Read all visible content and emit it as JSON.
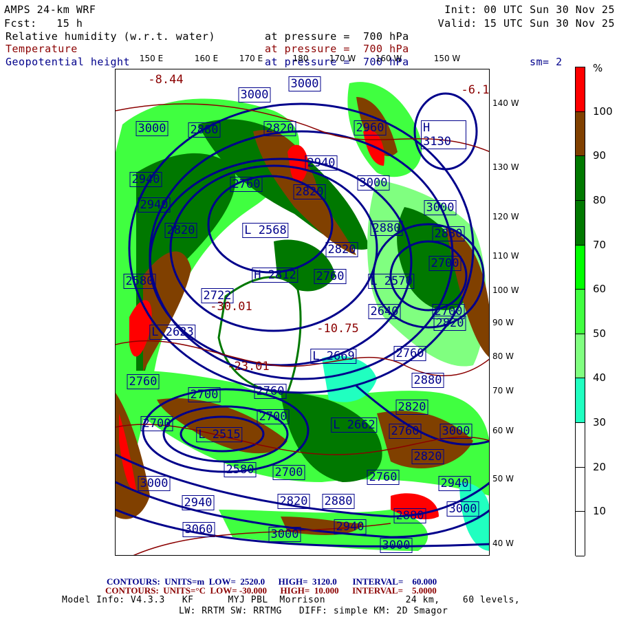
{
  "header": {
    "model": "AMPS 24-km WRF",
    "fcst": "Fcst:   15 h",
    "init": "Init: 00 UTC Sun 30 Nov 25",
    "valid": "Valid: 15 UTC Sun 30 Nov 25",
    "fields": [
      {
        "name": "Relative humidity (w.r.t. water)",
        "level": "at pressure =  700 hPa"
      },
      {
        "name": "Temperature",
        "level": "at pressure =  700 hPa"
      },
      {
        "name": "Geopotential height",
        "level": "at pressure =  700 hPa"
      }
    ],
    "smoothing": "sm= 2"
  },
  "colors": {
    "navy": "#00008b",
    "darkred": "#8b0000"
  },
  "longitude_labels": [
    "150 E",
    "160 E",
    "170 E",
    "180",
    "170 W",
    "160 W",
    "150 W"
  ],
  "latitude_labels": [
    "140 W",
    "130 W",
    "120 W",
    "110 W",
    "100 W",
    "90 W",
    "80 W",
    "70 W",
    "60 W",
    "50 W",
    "40 W"
  ],
  "colorbar": {
    "unit": "%",
    "ticks": [
      "100",
      "90",
      "80",
      "70",
      "60",
      "50",
      "40",
      "30",
      "20",
      "10"
    ],
    "colors": [
      "#ff0000",
      "#804000",
      "#007800",
      "#007800",
      "#00ff00",
      "#40ff40",
      "#80ff80",
      "#20ffc0",
      "#ffffff",
      "#ffffff",
      "#ffffff"
    ]
  },
  "height_labels": [
    "3000",
    "3000",
    "3000",
    "2880",
    "2820",
    "2960",
    "H 3130",
    "2940",
    "2940",
    "2760",
    "2820",
    "3000",
    "2940",
    "3000",
    "2820",
    "L 2568",
    "2880",
    "2880",
    "2820",
    "2700",
    "H 2812",
    "2760",
    "L 2570",
    "2580",
    "2722",
    "2640",
    "2700",
    "L 2623",
    "2820",
    "L 2669",
    "2760",
    "2760",
    "2880",
    "2700",
    "2760",
    "2820",
    "2700",
    "2700",
    "L 2515",
    "L 2662",
    "2760",
    "3000",
    "2820",
    "2580",
    "2700",
    "2760",
    "3000",
    "2940",
    "2940",
    "2820",
    "2880",
    "2880",
    "3000",
    "3060",
    "3000",
    "2940",
    "3000"
  ],
  "temperature_labels": [
    "-8.44",
    "-6.1",
    "-30.01",
    "-23.01",
    "-10.75"
  ],
  "footer": {
    "height_contours": "CONTOURS:  UNITS=m  LOW=  2520.0      HIGH=  3120.0       INTERVAL=    60.000",
    "temp_contours": "CONTOURS:  UNITS=°C  LOW= -30.000      HIGH=  10.000      INTERVAL=    5.0000",
    "model_info": "Model Info: V4.3.3   KF      MYJ PBL  Morrison              24 km,    60 levels,",
    "model_info2": "LW: RRTM SW: RRTMG   DIFF: simple KM: 2D Smagor"
  }
}
